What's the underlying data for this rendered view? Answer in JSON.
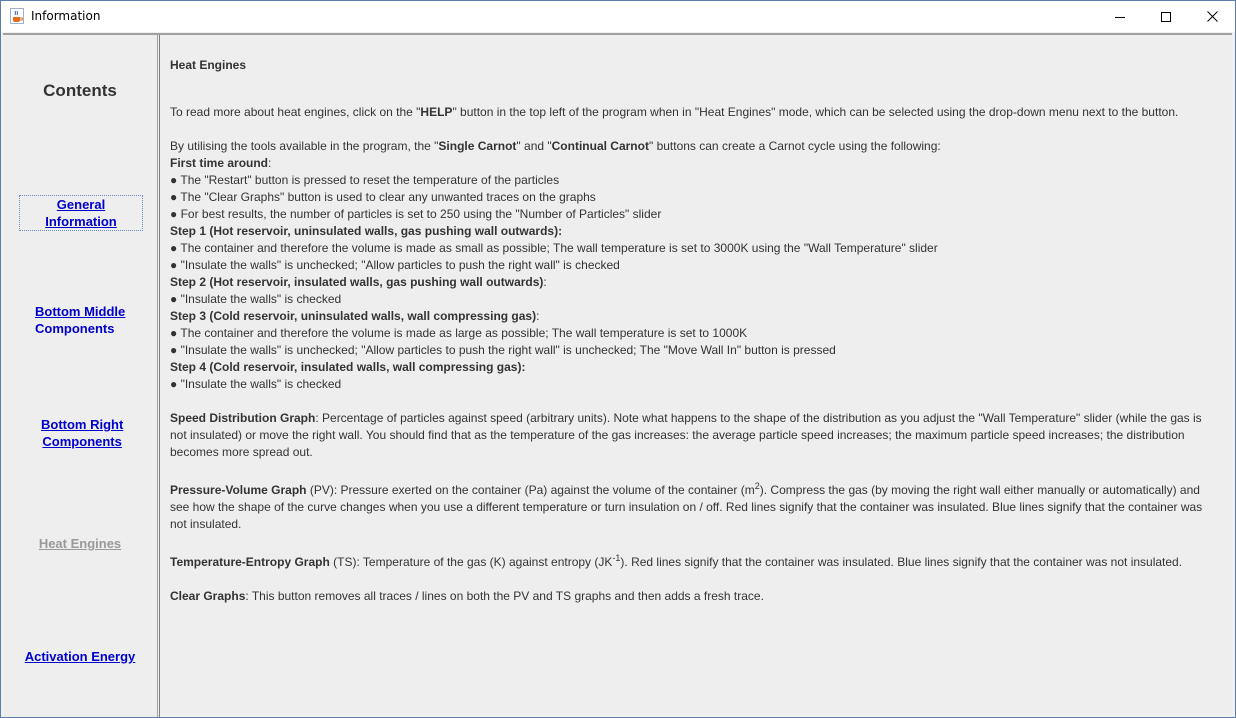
{
  "window": {
    "title": "Information",
    "icon": "java-cup-icon"
  },
  "sidebar": {
    "heading": "Contents",
    "items": [
      {
        "label": "General Information",
        "state": "focused"
      },
      {
        "label_line1": "Bottom Middle",
        "label_line2": "Components",
        "state": "normal"
      },
      {
        "label_line1": "Bottom Right",
        "label_line2": "Components",
        "state": "normal"
      },
      {
        "label": "Heat Engines",
        "state": "disabled"
      },
      {
        "label": "Activation Energy",
        "state": "normal"
      }
    ]
  },
  "content": {
    "heading": "Heat Engines",
    "intro": {
      "t1": "To read more about heat engines, click on the \"",
      "b1": "HELP",
      "t2": "\" button in the top left of the program when in \"Heat Engines\" mode, which can be selected using the drop-down menu next to the button."
    },
    "carnot": {
      "t1": "By utilising the tools available in the program, the \"",
      "b1": "Single Carnot",
      "t2": "\" and \"",
      "b2": "Continual Carnot",
      "t3": "\" buttons can create a Carnot cycle using the following:"
    },
    "first": {
      "heading": "First time around",
      "heading_suffix": ":",
      "bullets": [
        "● The \"Restart\" button is pressed to reset the temperature of the particles",
        "● The \"Clear Graphs\" button is used to clear any unwanted traces on the graphs",
        "● For best results, the number of particles is set to 250 using the \"Number of Particles\" slider"
      ]
    },
    "steps": [
      {
        "heading": "Step 1 (Hot reservoir, uninsulated walls, gas pushing wall outwards)",
        "heading_suffix": ":",
        "bullets": [
          "● The container and therefore the volume is made as small as possible; The wall temperature is set to 3000K using the \"Wall Temperature\" slider",
          "● \"Insulate the walls\" is unchecked; \"Allow particles to push the right wall\" is checked"
        ]
      },
      {
        "heading": "Step 2 (Hot reservoir, insulated walls, gas pushing wall outwards)",
        "heading_suffix": ":",
        "bullets": [
          "● \"Insulate the walls\" is checked"
        ]
      },
      {
        "heading": "Step 3 (Cold reservoir, uninsulated walls, wall compressing gas)",
        "heading_suffix": ":",
        "bullets": [
          "● The container and therefore the volume is made as large as possible; The wall temperature is set to 1000K",
          "● \"Insulate the walls\" is unchecked; \"Allow particles to push the right wall\" is unchecked; The \"Move Wall In\" button is pressed"
        ]
      },
      {
        "heading": "Step 4 (Cold reservoir, insulated walls, wall compressing gas)",
        "heading_suffix": ":",
        "bullets": [
          "● \"Insulate the walls\" is checked"
        ]
      }
    ],
    "speed": {
      "term": "Speed Distribution Graph",
      "text": ": Percentage of particles against speed (arbitrary units). Note what happens to the shape of the distribution as you adjust the \"Wall Temperature\" slider (while the gas is not insulated) or move the right wall. You should find that as the temperature of the gas increases: the average particle speed increases; the maximum particle speed increases; the distribution becomes more spread out."
    },
    "pv": {
      "term": "Pressure-Volume Graph",
      "t1": " (PV): Pressure exerted on the container (Pa) against the volume of the container (m",
      "sup": "2",
      "t2": "). Compress the gas (by moving the right wall either manually or automatically) and see how the shape of the curve changes when you use a different temperature or turn insulation on / off. Red lines signify that the container was insulated. Blue lines signify that the container was not insulated."
    },
    "ts": {
      "term": "Temperature-Entropy Graph",
      "t1": " (TS): Temperature of the gas (K) against entropy (JK",
      "sup": "-1",
      "t2": "). Red lines signify that the container was insulated. Blue lines signify that the container was not insulated."
    },
    "clear": {
      "term": "Clear Graphs",
      "text": ": This button removes all traces / lines on both the PV and TS graphs and then adds a fresh trace."
    }
  }
}
